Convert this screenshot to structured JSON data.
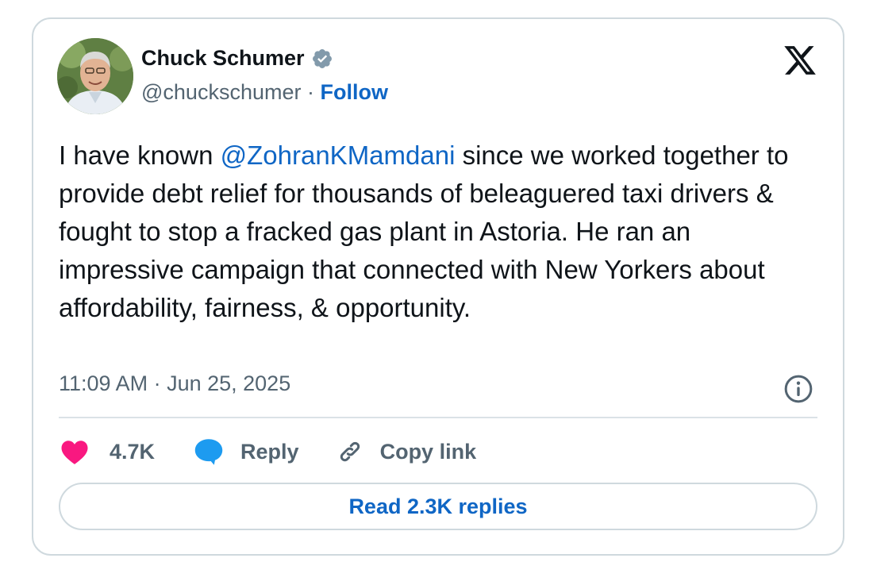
{
  "author": {
    "name": "Chuck Schumer",
    "handle": "@chuckschumer",
    "separator": " · ",
    "follow_label": "Follow",
    "verified": true
  },
  "tweet": {
    "text_before": "I have known ",
    "mention": "@ZohranKMamdani",
    "text_after": " since we worked together to provide debt relief for thousands of beleaguered taxi drivers & fought to stop a fracked gas plant in Astoria. He ran an impressive campaign that connected with New Yorkers about affordability, fairness, & opportunity.",
    "time": "11:09 AM",
    "date_separator": " · ",
    "date": "Jun 25, 2025"
  },
  "actions": {
    "like_count": "4.7K",
    "reply_label": "Reply",
    "copy_link_label": "Copy link"
  },
  "read_replies_label": "Read 2.3K replies",
  "icons": {
    "brand": "x-logo-icon",
    "verified": "verified-badge-icon",
    "info": "info-icon",
    "like": "heart-icon",
    "reply": "speech-bubble-icon",
    "copy_link": "link-icon"
  },
  "colors": {
    "link_blue": "#0f66c5",
    "heart_pink": "#f91880",
    "reply_blue": "#1d9bf0",
    "muted_text": "#536471",
    "verified_gray": "#829aab",
    "border": "#cfd9de"
  }
}
